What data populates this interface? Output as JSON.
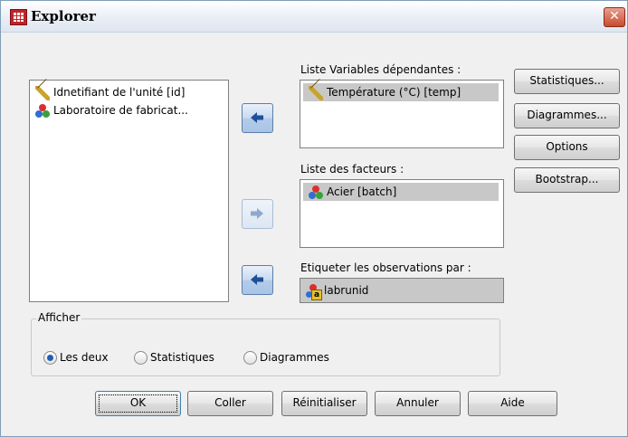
{
  "window": {
    "title": "Explorer",
    "close_glyph": "✕"
  },
  "source_list": {
    "items": [
      {
        "label": "Idnetifiant de l'unité [id]",
        "icon": "scale-ruler-icon"
      },
      {
        "label": "Laboratoire de fabricat...",
        "icon": "nominal-circles-icon"
      }
    ]
  },
  "dependent": {
    "label": "Liste Variables dépendantes :",
    "items": [
      "Température (°C) [temp]"
    ]
  },
  "factors": {
    "label": "Liste des facteurs :",
    "items": [
      "Acier [batch]"
    ]
  },
  "label_cases": {
    "label": "Etiqueter les observations par :",
    "value": "labrunid"
  },
  "side_buttons": [
    "Statistiques...",
    "Diagrammes...",
    "Options",
    "Bootstrap..."
  ],
  "display": {
    "title": "Afficher",
    "options": [
      "Les deux",
      "Statistiques",
      "Diagrammes"
    ],
    "selected": "Les deux"
  },
  "bottom_buttons": [
    "OK",
    "Coller",
    "Réinitialiser",
    "Annuler",
    "Aide"
  ],
  "colors": {
    "titlebar": "#e9eef6",
    "selection": "#c8c8c8",
    "close": "#c84a2f",
    "arrow": "#1f4f96"
  }
}
